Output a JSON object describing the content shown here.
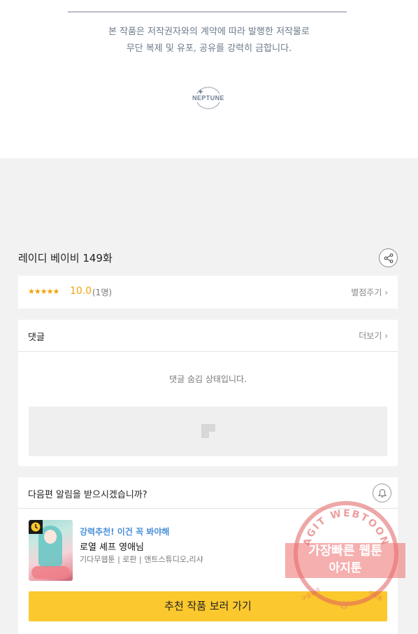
{
  "notice": {
    "line1": "본 작품은 저작권자와의 계약에 따라 발행한 저작물로",
    "line2": "무단 복제 및 유포, 공유를 강력히 금합니다."
  },
  "publisher_logo": "NEPTUNE",
  "episode": {
    "title": "레이디 베이비 149화",
    "share_icon": "share-icon"
  },
  "rating": {
    "stars": "★★★★★",
    "score": "10.0",
    "count": "(1명)",
    "rate_label": "별점주기 ›"
  },
  "comments": {
    "title": "댓글",
    "more_label": "더보기 ›",
    "hidden_message": "댓글 숨김 상태입니다."
  },
  "notify": {
    "question": "다음편 알림을 받으시겠습니까?",
    "bell_icon": "bell-icon"
  },
  "recommendation": {
    "tag": "강력추천! 이건 꼭 봐야해",
    "title": "로열 셰프 영애님",
    "meta": "기다무웹툰 | 로판 | 앤트스튜디오,리샤",
    "button_label": "추천 작품 보러 가기"
  },
  "watermark": {
    "arc_text": "AGIT WEBTOON",
    "line1": "가장빠른 웹툰",
    "line2": "아지툰",
    "search_text": "구글검색",
    "brand_text": "아지툰"
  },
  "colors": {
    "accent_yellow": "#fbc82d",
    "star_orange": "#f0a30a",
    "rec_blue": "#4a90d9"
  }
}
